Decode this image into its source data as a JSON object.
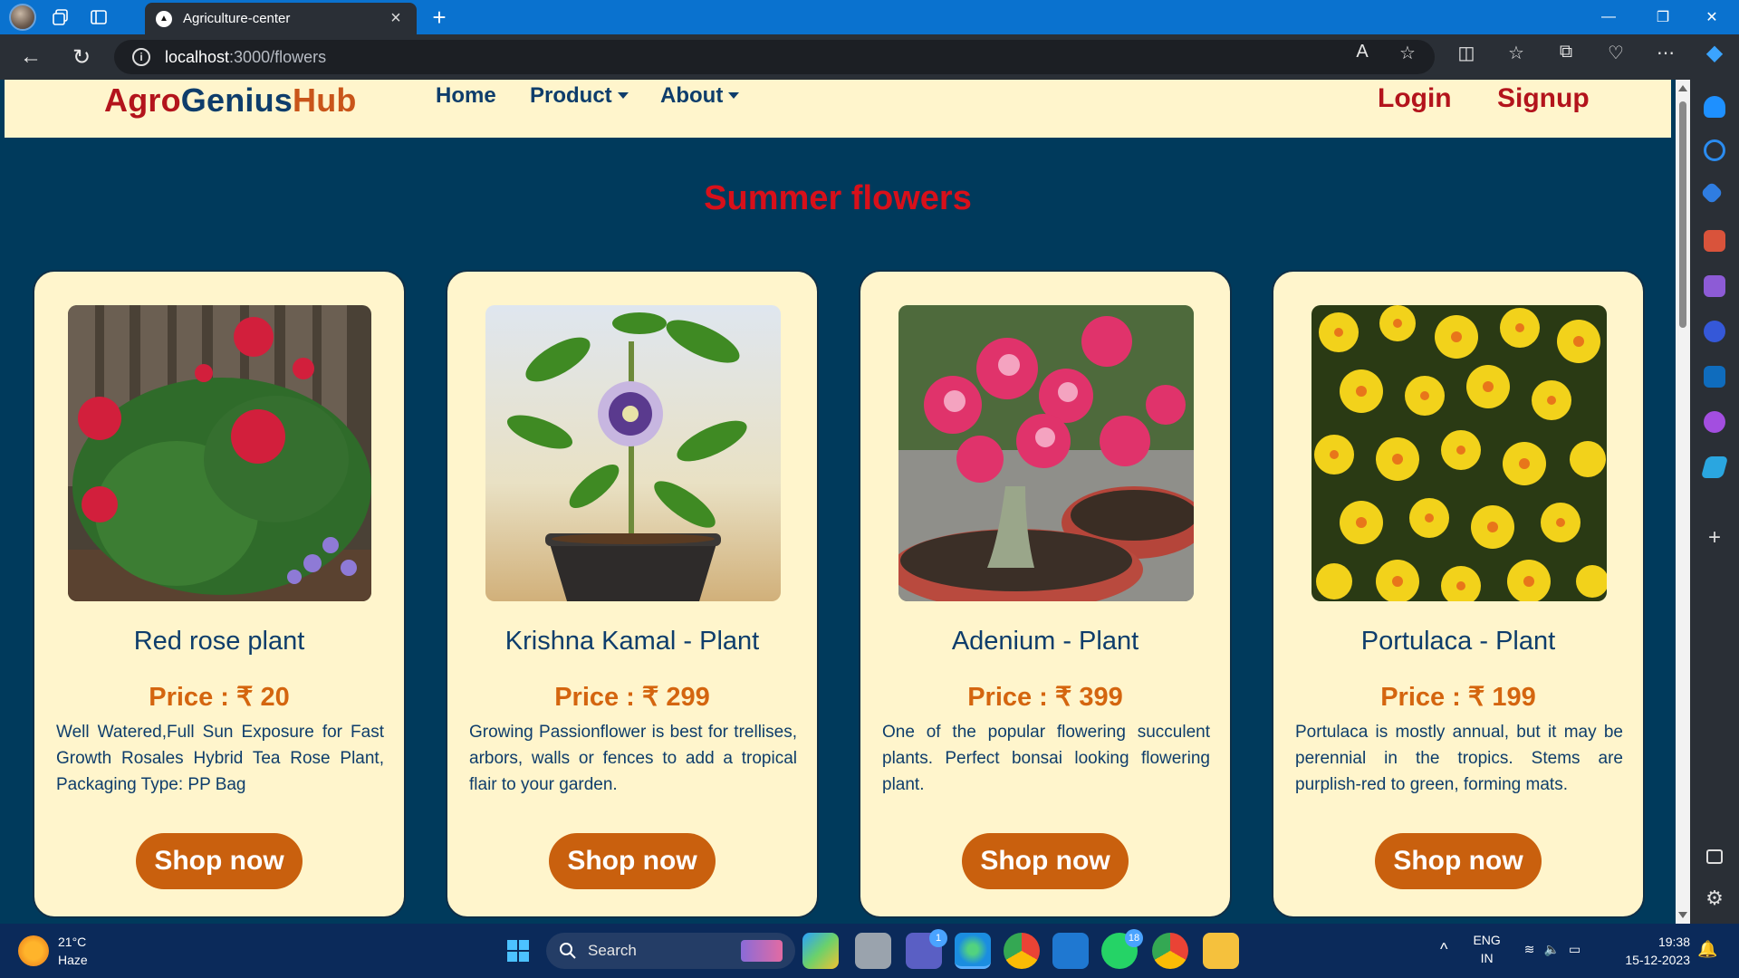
{
  "browser": {
    "tab_title": "Agriculture-center",
    "url_host": "localhost",
    "url_path": ":3000/flowers"
  },
  "site": {
    "brand": {
      "part1": "Agro",
      "part2": "Genius",
      "part3": "Hub"
    },
    "nav": {
      "home": "Home",
      "product": "Product",
      "about": "About"
    },
    "auth": {
      "login": "Login",
      "signup": "Signup"
    },
    "heading": "Summer flowers"
  },
  "products": [
    {
      "name": "Red rose plant",
      "price": "Price : ₹ 20",
      "description": "Well Watered,Full Sun Exposure for Fast Growth Rosales Hybrid Tea Rose Plant, Packaging Type: PP Bag",
      "button": "Shop now"
    },
    {
      "name": "Krishna Kamal - Plant",
      "price": "Price : ₹ 299",
      "description": "Growing Passionflower is best for trellises, arbors, walls or fences to add a tropical flair to your garden.",
      "button": "Shop now"
    },
    {
      "name": "Adenium - Plant",
      "price": "Price : ₹ 399",
      "description": "One of the popular flowering succulent plants. Perfect bonsai looking flowering plant.",
      "button": "Shop now"
    },
    {
      "name": "Portulaca - Plant",
      "price": "Price : ₹ 199",
      "description": "Portulaca is mostly annual, but it may be perennial in the tropics. Stems are purplish-red to green, forming mats.",
      "button": "Shop now"
    }
  ],
  "taskbar": {
    "weather_temp": "21°C",
    "weather_cond": "Haze",
    "search_label": "Search",
    "teams_badge": "1",
    "whatsapp_badge": "18",
    "lang1": "ENG",
    "lang2": "IN",
    "time": "19:38",
    "date": "15-12-2023"
  },
  "colors": {
    "page_bg": "#003a5c",
    "card_bg": "#fff5cc",
    "brand_red": "#b3141c",
    "brand_blue": "#0e3d6b",
    "accent_orange": "#c9600e"
  }
}
